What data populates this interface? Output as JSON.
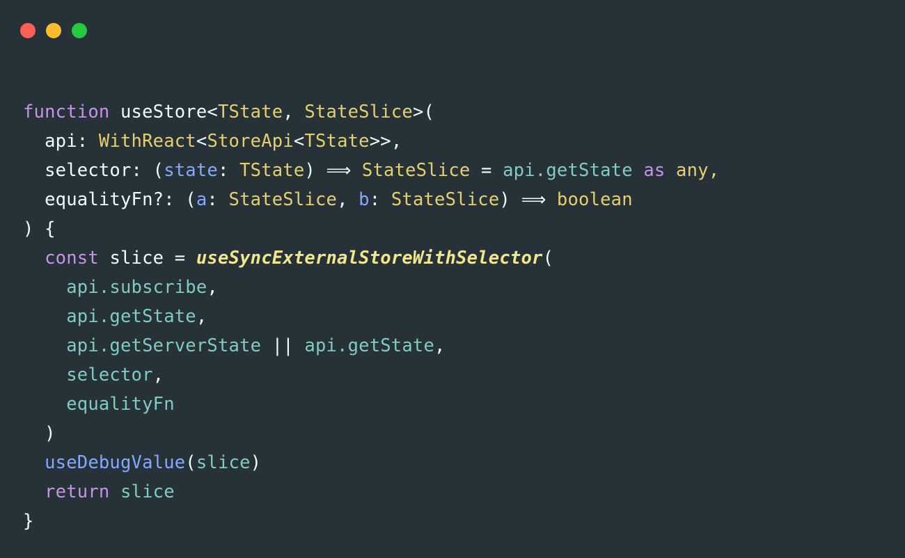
{
  "window": {
    "background_color": "#263238",
    "traffic_lights": [
      {
        "name": "close",
        "color": "#ff5f56",
        "label": "Close"
      },
      {
        "name": "minimize",
        "color": "#ffbd2e",
        "label": "Minimize"
      },
      {
        "name": "maximize",
        "color": "#27c93f",
        "label": "Maximize"
      }
    ]
  },
  "theme": {
    "name": "Material Ocean",
    "foreground": "#eeffff",
    "keyword": "#c792ea",
    "type": "#e6d06c",
    "parameter": "#82aaff",
    "variable": "#80cbc4",
    "call": "#82aaff",
    "import": "#f0e68c",
    "punctuation": "#eeffff"
  },
  "code": {
    "language": "typescript",
    "full_text": "function useStore<TState, StateSlice>(\n  api: WithReact<StoreApi<TState>>,\n  selector: (state: TState) => StateSlice = api.getState as any,\n  equalityFn?: (a: StateSlice, b: StateSlice) => boolean\n) {\n  const slice = useSyncExternalStoreWithSelector(\n    api.subscribe,\n    api.getState,\n    api.getServerState || api.getState,\n    selector,\n    equalityFn\n  )\n  useDebugValue(slice)\n  return slice\n}",
    "lines": [
      {
        "n": 1,
        "tokens": [
          {
            "t": "function",
            "c": "kw"
          },
          {
            "t": " ",
            "c": "plain"
          },
          {
            "t": "useStore",
            "c": "fn"
          },
          {
            "t": "<",
            "c": "punct"
          },
          {
            "t": "TState",
            "c": "type"
          },
          {
            "t": ", ",
            "c": "punct"
          },
          {
            "t": "StateSlice",
            "c": "type"
          },
          {
            "t": ">(",
            "c": "punct"
          }
        ]
      },
      {
        "n": 2,
        "tokens": [
          {
            "t": "  ",
            "c": "plain"
          },
          {
            "t": "api",
            "c": "plain"
          },
          {
            "t": ": ",
            "c": "punct"
          },
          {
            "t": "WithReact",
            "c": "type"
          },
          {
            "t": "<",
            "c": "punct"
          },
          {
            "t": "StoreApi",
            "c": "type"
          },
          {
            "t": "<",
            "c": "punct"
          },
          {
            "t": "TState",
            "c": "type"
          },
          {
            "t": ">>,",
            "c": "punct"
          }
        ]
      },
      {
        "n": 3,
        "tokens": [
          {
            "t": "  ",
            "c": "plain"
          },
          {
            "t": "selector",
            "c": "plain"
          },
          {
            "t": ": (",
            "c": "punct"
          },
          {
            "t": "state",
            "c": "param"
          },
          {
            "t": ": ",
            "c": "punct"
          },
          {
            "t": "TState",
            "c": "type"
          },
          {
            "t": ") ",
            "c": "punct"
          },
          {
            "t": "⟹",
            "c": "arrow"
          },
          {
            "t": " ",
            "c": "plain"
          },
          {
            "t": "StateSlice",
            "c": "type"
          },
          {
            "t": " = ",
            "c": "punct"
          },
          {
            "t": "api",
            "c": "var"
          },
          {
            "t": ".",
            "c": "var"
          },
          {
            "t": "getState",
            "c": "var"
          },
          {
            "t": " ",
            "c": "plain"
          },
          {
            "t": "as",
            "c": "kw"
          },
          {
            "t": " ",
            "c": "plain"
          },
          {
            "t": "any",
            "c": "type"
          },
          {
            "t": ",",
            "c": "type"
          }
        ]
      },
      {
        "n": 4,
        "tokens": [
          {
            "t": "  ",
            "c": "plain"
          },
          {
            "t": "equalityFn?",
            "c": "plain"
          },
          {
            "t": ": (",
            "c": "punct"
          },
          {
            "t": "a",
            "c": "param"
          },
          {
            "t": ": ",
            "c": "punct"
          },
          {
            "t": "StateSlice",
            "c": "type"
          },
          {
            "t": ", ",
            "c": "punct"
          },
          {
            "t": "b",
            "c": "param"
          },
          {
            "t": ": ",
            "c": "punct"
          },
          {
            "t": "StateSlice",
            "c": "type"
          },
          {
            "t": ") ",
            "c": "punct"
          },
          {
            "t": "⟹",
            "c": "arrow"
          },
          {
            "t": " ",
            "c": "plain"
          },
          {
            "t": "boolean",
            "c": "type"
          }
        ]
      },
      {
        "n": 5,
        "tokens": [
          {
            "t": ") {",
            "c": "punct"
          }
        ]
      },
      {
        "n": 6,
        "tokens": [
          {
            "t": "  ",
            "c": "plain"
          },
          {
            "t": "const",
            "c": "kw"
          },
          {
            "t": " ",
            "c": "plain"
          },
          {
            "t": "slice",
            "c": "plain"
          },
          {
            "t": " = ",
            "c": "punct"
          },
          {
            "t": "useSyncExternalStoreWithSelector",
            "c": "import"
          },
          {
            "t": "(",
            "c": "punct"
          }
        ]
      },
      {
        "n": 7,
        "tokens": [
          {
            "t": "    ",
            "c": "plain"
          },
          {
            "t": "api.subscribe",
            "c": "var"
          },
          {
            "t": ",",
            "c": "punct"
          }
        ]
      },
      {
        "n": 8,
        "tokens": [
          {
            "t": "    ",
            "c": "plain"
          },
          {
            "t": "api.getState",
            "c": "var"
          },
          {
            "t": ",",
            "c": "punct"
          }
        ]
      },
      {
        "n": 9,
        "tokens": [
          {
            "t": "    ",
            "c": "plain"
          },
          {
            "t": "api.getServerState",
            "c": "var"
          },
          {
            "t": " || ",
            "c": "punct"
          },
          {
            "t": "api.getState",
            "c": "var"
          },
          {
            "t": ",",
            "c": "punct"
          }
        ]
      },
      {
        "n": 10,
        "tokens": [
          {
            "t": "    ",
            "c": "plain"
          },
          {
            "t": "selector",
            "c": "var"
          },
          {
            "t": ",",
            "c": "punct"
          }
        ]
      },
      {
        "n": 11,
        "tokens": [
          {
            "t": "    ",
            "c": "plain"
          },
          {
            "t": "equalityFn",
            "c": "var"
          }
        ]
      },
      {
        "n": 12,
        "tokens": [
          {
            "t": "  ",
            "c": "plain"
          },
          {
            "t": ")",
            "c": "punct"
          }
        ]
      },
      {
        "n": 13,
        "tokens": [
          {
            "t": "  ",
            "c": "plain"
          },
          {
            "t": "useDebugValue",
            "c": "call"
          },
          {
            "t": "(",
            "c": "punct"
          },
          {
            "t": "slice",
            "c": "var"
          },
          {
            "t": ")",
            "c": "punct"
          }
        ]
      },
      {
        "n": 14,
        "tokens": [
          {
            "t": "  ",
            "c": "plain"
          },
          {
            "t": "return",
            "c": "kw"
          },
          {
            "t": " ",
            "c": "plain"
          },
          {
            "t": "slice",
            "c": "var"
          }
        ]
      },
      {
        "n": 15,
        "tokens": [
          {
            "t": "}",
            "c": "punct"
          }
        ]
      }
    ]
  }
}
